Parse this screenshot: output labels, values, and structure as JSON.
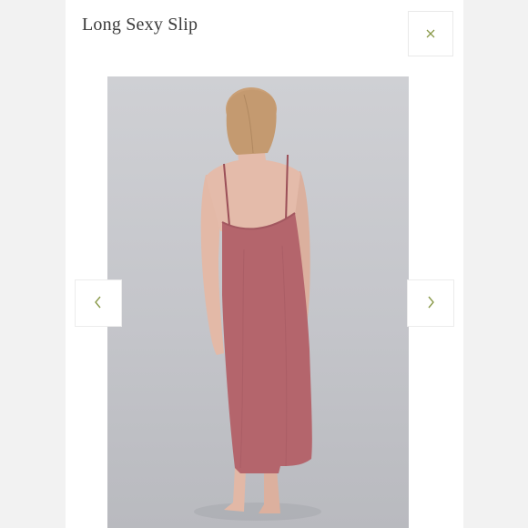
{
  "modal": {
    "title": "Long Sexy Slip"
  },
  "icons": {
    "close": "close-icon",
    "prev": "chevron-left-icon",
    "next": "chevron-right-icon"
  },
  "colors": {
    "icon_accent": "#8a9a4a",
    "slip": "#b4656c",
    "background": "#f2f2f2"
  }
}
